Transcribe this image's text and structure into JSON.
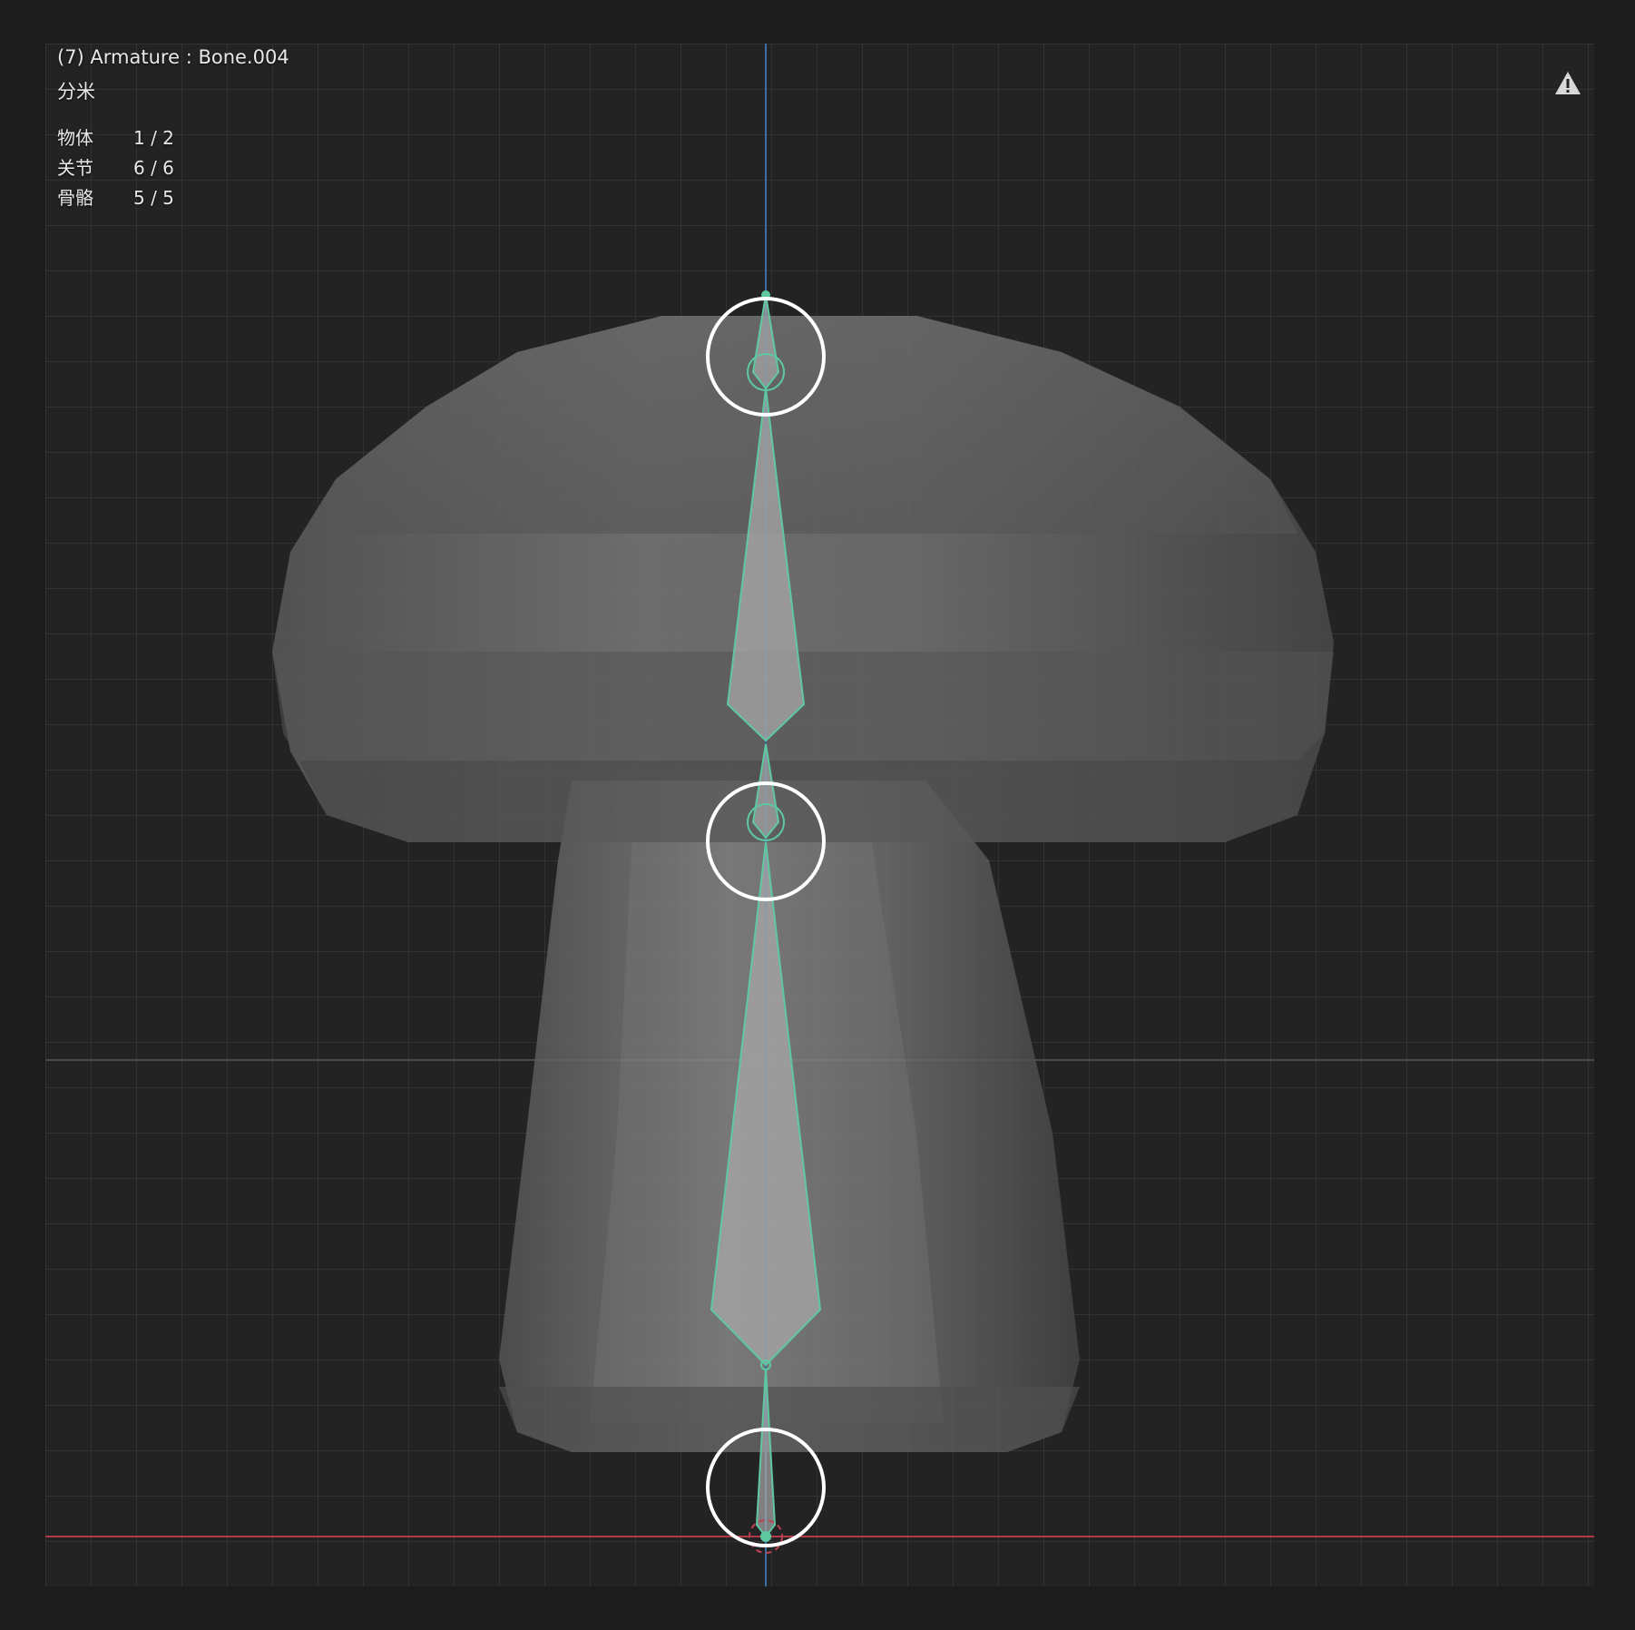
{
  "viewport": {
    "object_info": "(7) Armature : Bone.004",
    "grid_unit": "分米",
    "stats": [
      {
        "label": "物体",
        "value": "1 / 2"
      },
      {
        "label": "关节",
        "value": "6 / 6"
      },
      {
        "label": "骨骼",
        "value": "5 / 5"
      }
    ],
    "warning_icon": "warning-triangle-icon"
  },
  "colors": {
    "background": "#1c1c1c",
    "viewport": "#232323",
    "grid_line": "#3a3a3a",
    "bone_outline": "#5ec9a0",
    "y_axis": "#3d6ea8",
    "x_axis": "#b03a48",
    "mesh": "#6e6e6e"
  }
}
